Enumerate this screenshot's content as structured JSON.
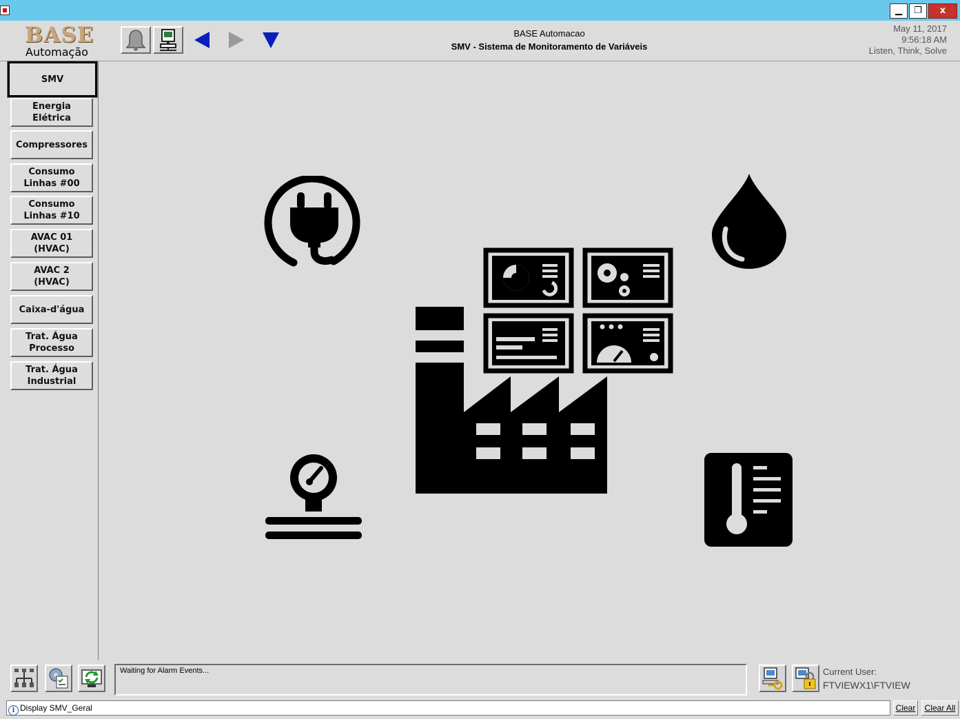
{
  "window": {
    "minimize_glyph": "▁",
    "maximize_glyph": "❐",
    "close_glyph": "x"
  },
  "header": {
    "logo_main": "BASE",
    "logo_sub": "Automação",
    "company": "BASE Automacao",
    "title": "SMV - Sistema de Monitoramento de Variáveis",
    "date": "May 11, 2017",
    "time": "9:56:18 AM",
    "slogan": "Listen, Think, Solve",
    "toolbar_icons": [
      "bell-icon",
      "station-icon",
      "back-arrow-icon",
      "forward-arrow-icon",
      "down-arrow-icon"
    ]
  },
  "sidebar": {
    "items": [
      {
        "label": "SMV",
        "active": true
      },
      {
        "label": "Energia\nElétrica"
      },
      {
        "label": "Compressores"
      },
      {
        "label": "Consumo\nLinhas #00"
      },
      {
        "label": "Consumo\nLinhas #10"
      },
      {
        "label": "AVAC 01\n(HVAC)"
      },
      {
        "label": "AVAC 2\n(HVAC)"
      },
      {
        "label": "Caixa-d'água"
      },
      {
        "label": "Trat. Água\nProcesso"
      },
      {
        "label": "Trat. Água\nIndustrial"
      }
    ]
  },
  "main": {
    "icons": [
      "power-plug-icon",
      "water-drop-icon",
      "factory-icon",
      "pressure-gauge-icon",
      "thermometer-icon"
    ]
  },
  "bottom": {
    "alarm_text": "Waiting for Alarm Events...",
    "current_user_label": "Current User:",
    "current_user": "FTVIEWX1\\FTVIEW"
  },
  "statusbar": {
    "message": "Display SMV_Geral",
    "clear_label": "Clear",
    "clear_all_label": "Clear All"
  },
  "colors": {
    "titlebar": "#69c9ec",
    "close_button": "#c7322b",
    "background": "#dcdcdc",
    "nav_arrow": "#0a1ebe"
  }
}
